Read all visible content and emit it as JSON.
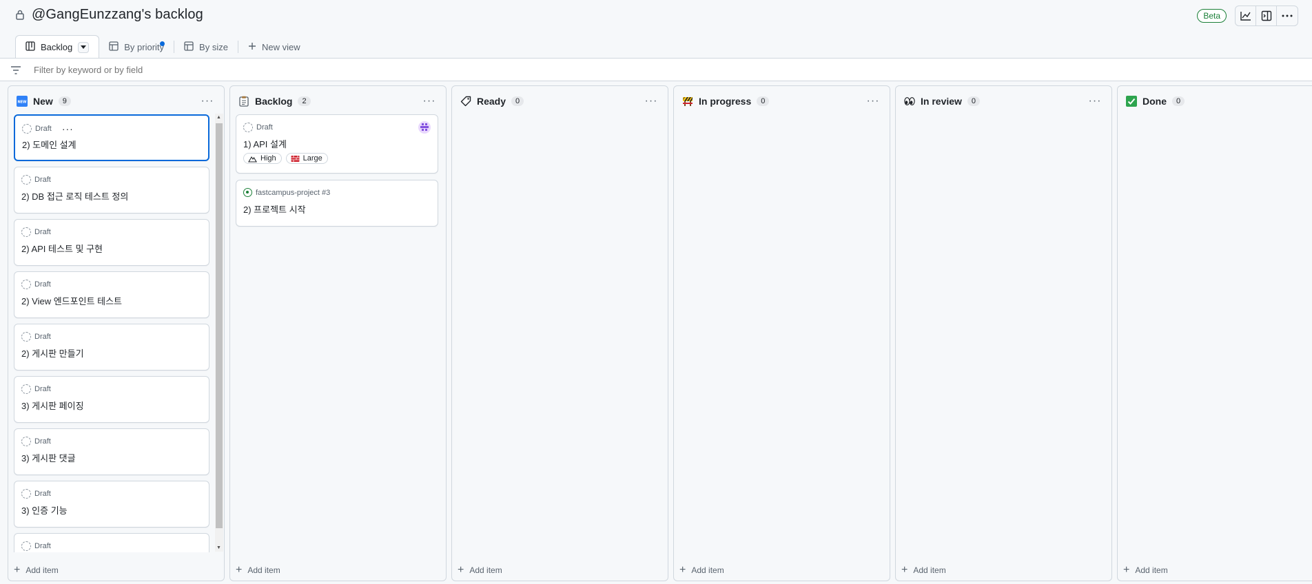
{
  "header": {
    "title": "@GangEunzzang's backlog",
    "beta_label": "Beta",
    "actions": [
      "insights-icon",
      "side-panel-icon",
      "more-options-icon"
    ]
  },
  "tabs": [
    {
      "label": "Backlog",
      "icon": "board-icon",
      "active": true
    },
    {
      "label": "By priority",
      "icon": "table-icon",
      "unsaved": true
    },
    {
      "label": "By size",
      "icon": "table-icon"
    },
    {
      "label": "New view",
      "icon": "plus-icon"
    }
  ],
  "filter": {
    "placeholder": "Filter by keyword or by field"
  },
  "columns": [
    {
      "name": "New",
      "count": "9",
      "icon": "new-button-emoji",
      "add_item": "Add item",
      "cards": [
        {
          "type": "Draft",
          "title": "2) 도메인 설계"
        },
        {
          "type": "Draft",
          "title": "2) DB 접근 로직 테스트 정의"
        },
        {
          "type": "Draft",
          "title": "2) API 테스트 및 구현"
        },
        {
          "type": "Draft",
          "title": "2) View 엔드포인트 테스트"
        },
        {
          "type": "Draft",
          "title": "2) 게시판 만들기"
        },
        {
          "type": "Draft",
          "title": "3) 게시판 페이징"
        },
        {
          "type": "Draft",
          "title": "3) 게시판 댓글"
        },
        {
          "type": "Draft",
          "title": "3) 인증 기능"
        },
        {
          "type": "Draft",
          "title": ""
        }
      ]
    },
    {
      "name": "Backlog",
      "count": "2",
      "icon": "clipboard-emoji",
      "add_item": "Add item",
      "cards": [
        {
          "type": "Draft",
          "title": "1) API 설계",
          "labels": [
            {
              "text": "High"
            },
            {
              "text": "Large"
            }
          ]
        },
        {
          "type": "fastcampus-project #3",
          "title": "2) 프로젝트 시작"
        }
      ]
    },
    {
      "name": "Ready",
      "count": "0",
      "icon": "label-emoji",
      "add_item": "Add item"
    },
    {
      "name": "In progress",
      "count": "0",
      "icon": "construction-emoji",
      "add_item": "Add item"
    },
    {
      "name": "In review",
      "count": "0",
      "icon": "eyes-emoji",
      "add_item": "Add item"
    },
    {
      "name": "Done",
      "count": "0",
      "icon": "check-mark-emoji",
      "add_item": "Add item"
    }
  ],
  "colors": {
    "accent": "#0969da",
    "open": "#1a7f37",
    "border": "#d0d7de"
  }
}
